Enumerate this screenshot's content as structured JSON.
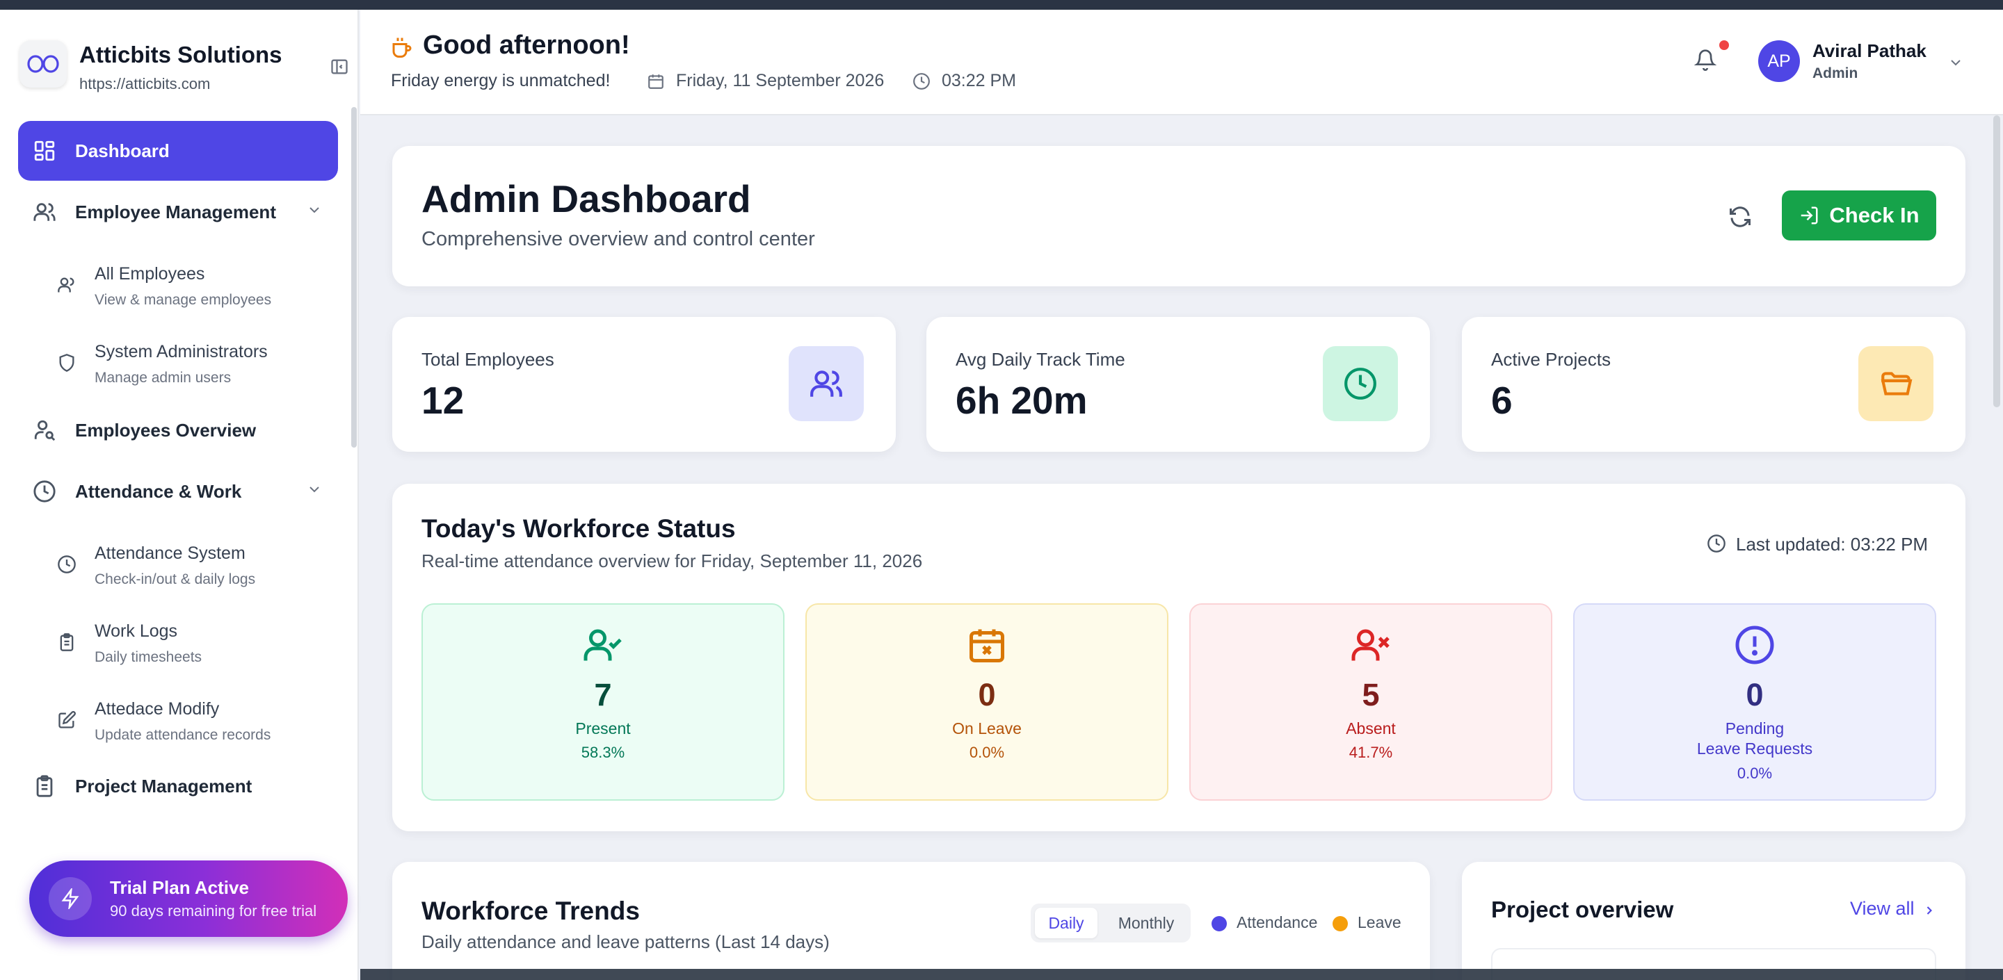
{
  "brand": {
    "name": "Atticbits Solutions",
    "url": "https://atticbits.com"
  },
  "sidebar": {
    "items": [
      {
        "label": "Dashboard",
        "icon": "dashboard-icon",
        "active": true
      },
      {
        "label": "Employee Management",
        "icon": "users-icon"
      },
      {
        "label": "Employees Overview",
        "icon": "user-search-icon"
      },
      {
        "label": "Attendance & Work",
        "icon": "clock-icon"
      },
      {
        "label": "Project Management",
        "icon": "clipboard-icon"
      }
    ],
    "employee_sub": [
      {
        "title": "All Employees",
        "desc": "View & manage employees",
        "icon": "users-icon"
      },
      {
        "title": "System Administrators",
        "desc": "Manage admin users",
        "icon": "shield-icon"
      }
    ],
    "attendance_sub": [
      {
        "title": "Attendance System",
        "desc": "Check-in/out & daily logs",
        "icon": "clock-icon"
      },
      {
        "title": "Work Logs",
        "desc": "Daily timesheets",
        "icon": "clipboard-icon"
      },
      {
        "title": "Attedace Modify",
        "desc": "Update attendance records",
        "icon": "edit-icon"
      }
    ],
    "trial": {
      "title": "Trial Plan Active",
      "subtitle": "90 days remaining for free trial"
    }
  },
  "header": {
    "greeting": "Good afternoon!",
    "subtext": "Friday energy is unmatched!",
    "date": "Friday, 11 September 2026",
    "time": "03:22 PM",
    "user": {
      "initials": "AP",
      "name": "Aviral Pathak",
      "role": "Admin"
    }
  },
  "main": {
    "title": "Admin Dashboard",
    "subtitle": "Comprehensive overview and control center",
    "checkin_label": "Check In",
    "stats": [
      {
        "label": "Total Employees",
        "value": "12",
        "icon": "users-icon",
        "color": "#4f46e5",
        "bg": "#e0e3fc"
      },
      {
        "label": "Avg Daily Track Time",
        "value": "6h 20m",
        "icon": "clock-icon",
        "color": "#059669",
        "bg": "#cdf5e2"
      },
      {
        "label": "Active Projects",
        "value": "6",
        "icon": "folder-icon",
        "color": "#ea7c0c",
        "bg": "#fde9b4"
      }
    ],
    "workforce": {
      "title": "Today's Workforce Status",
      "subtitle": "Real-time attendance overview for Friday, September 11, 2026",
      "last_updated": "Last updated: 03:22 PM",
      "boxes": [
        {
          "count": "7",
          "label": "Present",
          "pct": "58.3%",
          "icon": "user-check-icon"
        },
        {
          "count": "0",
          "label": "On Leave",
          "pct": "0.0%",
          "icon": "calendar-x-icon"
        },
        {
          "count": "5",
          "label": "Absent",
          "pct": "41.7%",
          "icon": "user-x-icon"
        },
        {
          "count": "0",
          "label_line1": "Pending",
          "label_line2": "Leave Requests",
          "pct": "0.0%",
          "icon": "alert-circle-icon"
        }
      ]
    },
    "trends": {
      "title": "Workforce Trends",
      "subtitle": "Daily attendance and leave patterns (Last 14 days)",
      "toggle": [
        "Daily",
        "Monthly"
      ],
      "legend": [
        {
          "label": "Attendance",
          "color": "#4f46e5"
        },
        {
          "label": "Leave",
          "color": "#f59e0b"
        }
      ]
    },
    "projects": {
      "title": "Project overview",
      "view_all": "View all"
    }
  }
}
